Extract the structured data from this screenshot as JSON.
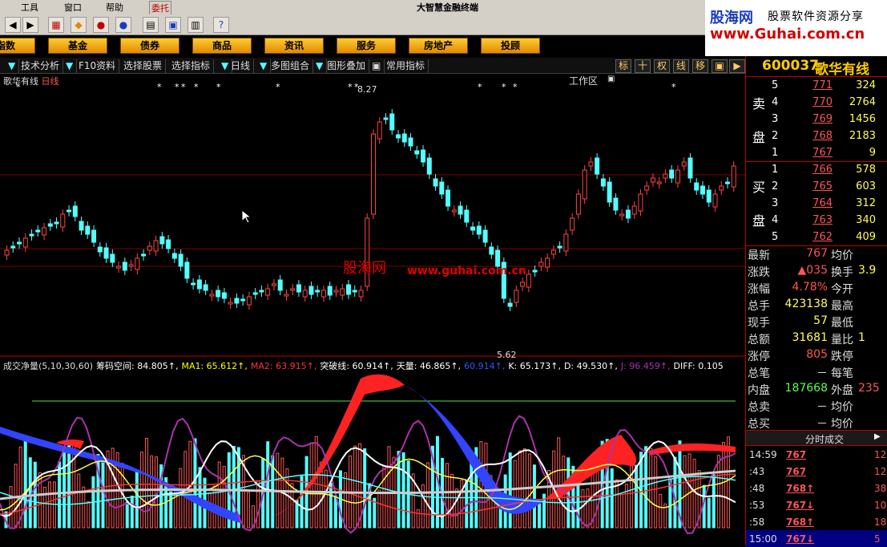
{
  "menu": {
    "items": [
      "工具",
      "窗口",
      "帮助"
    ],
    "trade_button": "委托",
    "app_title": "大智慧金融终端"
  },
  "ad": {
    "brand": "股海网",
    "slogan": "股票软件资源分享",
    "url": "www.Guhai.com.cn"
  },
  "navbar": {
    "buttons": [
      "指数",
      "基金",
      "债券",
      "商品",
      "资讯",
      "服务",
      "房地产",
      "投顾"
    ],
    "workspace_label": "工作区"
  },
  "tabbar": {
    "tabs": [
      "技术分析",
      "F10资料",
      "选择股票",
      "选择指标",
      "日线",
      "多图组合",
      "图形叠加",
      "常用指标"
    ],
    "tool_buttons": [
      "标",
      "十",
      "权",
      "线",
      "移"
    ]
  },
  "chart": {
    "stock_title": "歌华有线",
    "period": "日线",
    "high_label": "8.27",
    "low_label": "5.62",
    "watermark_site": "股海网",
    "watermark_url": "www.guhai.com.cn",
    "indicator_items": [
      {
        "text": "成交净量(5,10,30,60)",
        "color": "#dddddd"
      },
      {
        "text": "筹码空间: 84.805↑,",
        "color": "#ffffff"
      },
      {
        "text": "MA1: 65.612↑,",
        "color": "#ffff00"
      },
      {
        "text": "MA2: 63.915↑,",
        "color": "#ff3333"
      },
      {
        "text": "突破线: 60.914↑,",
        "color": "#ffffff"
      },
      {
        "text": "天量: 46.865↑,",
        "color": "#ffffff"
      },
      {
        "text": "60.914↑,",
        "color": "#3355ff"
      },
      {
        "text": "K: 65.173↑,",
        "color": "#ffffff"
      },
      {
        "text": "D: 49.530↑,",
        "color": "#ffffff"
      },
      {
        "text": "J: 96.459↑,",
        "color": "#aa33aa"
      },
      {
        "text": "DIFF: 0.105",
        "color": "#ffffff"
      }
    ],
    "colors": {
      "up": "#ff4444",
      "down": "#54ffff",
      "grid": "#800000",
      "text": "#dddddd"
    }
  },
  "quote": {
    "code": "600037",
    "name": "歌华有线",
    "sell_label": [
      "卖",
      "盘"
    ],
    "buy_label": [
      "买",
      "盘"
    ],
    "asks": [
      {
        "level": "5",
        "price": "771",
        "volume": "324"
      },
      {
        "level": "4",
        "price": "770",
        "volume": "2764"
      },
      {
        "level": "3",
        "price": "769",
        "volume": "1456"
      },
      {
        "level": "2",
        "price": "768",
        "volume": "2183"
      },
      {
        "level": "1",
        "price": "767",
        "volume": "9"
      }
    ],
    "bids": [
      {
        "level": "1",
        "price": "766",
        "volume": "578"
      },
      {
        "level": "2",
        "price": "765",
        "volume": "603"
      },
      {
        "level": "3",
        "price": "764",
        "volume": "312"
      },
      {
        "level": "4",
        "price": "763",
        "volume": "340"
      },
      {
        "level": "5",
        "price": "762",
        "volume": "409"
      }
    ],
    "stats": [
      {
        "k1": "最新",
        "v1": "767",
        "c1": "#ff5555",
        "k2": "均价",
        "v2": "",
        "c2": "#ddd"
      },
      {
        "k1": "涨跌",
        "v1": "▲035",
        "c1": "#ff5555",
        "k2": "换手",
        "v2": "3.9",
        "c2": "#ffff55"
      },
      {
        "k1": "涨幅",
        "v1": "4.78%",
        "c1": "#ff5555",
        "k2": "今开",
        "v2": "",
        "c2": "#ddd"
      },
      {
        "k1": "总手",
        "v1": "423138",
        "c1": "#ffff55",
        "k2": "最高",
        "v2": "",
        "c2": "#ddd"
      },
      {
        "k1": "现手",
        "v1": "57",
        "c1": "#ffff55",
        "k2": "最低",
        "v2": "",
        "c2": "#ddd"
      },
      {
        "k1": "总额",
        "v1": "31681",
        "c1": "#ffff55",
        "k2": "量比",
        "v2": "1",
        "c2": "#ffff55"
      },
      {
        "k1": "涨停",
        "v1": "805",
        "c1": "#ff5555",
        "k2": "跌停",
        "v2": "",
        "c2": "#ddd"
      },
      {
        "k1": "总笔",
        "v1": "－",
        "c1": "#ddd",
        "k2": "每笔",
        "v2": "",
        "c2": "#ddd"
      },
      {
        "k1": "内盘",
        "v1": "187668",
        "c1": "#55ff55",
        "k2": "外盘",
        "v2": "235",
        "c2": "#ff5555"
      },
      {
        "k1": "总卖",
        "v1": "－",
        "c1": "#ddd",
        "k2": "均价",
        "v2": "",
        "c2": "#ddd"
      },
      {
        "k1": "总买",
        "v1": "－",
        "c1": "#ddd",
        "k2": "均价",
        "v2": "",
        "c2": "#ddd"
      }
    ],
    "trades_title": "分时成交",
    "trades": [
      {
        "time": "14:59",
        "price": "767",
        "arrow": "",
        "vol": "12"
      },
      {
        "time": ":43",
        "price": "767",
        "arrow": "",
        "vol": "12"
      },
      {
        "time": ":48",
        "price": "768",
        "arrow": "↑",
        "vol": "38"
      },
      {
        "time": ":53",
        "price": "767",
        "arrow": "↓",
        "vol": "10"
      },
      {
        "time": ":58",
        "price": "768",
        "arrow": "↑",
        "vol": "18"
      },
      {
        "time": "15:00",
        "price": "767",
        "arrow": "↓",
        "vol": "5"
      }
    ]
  }
}
